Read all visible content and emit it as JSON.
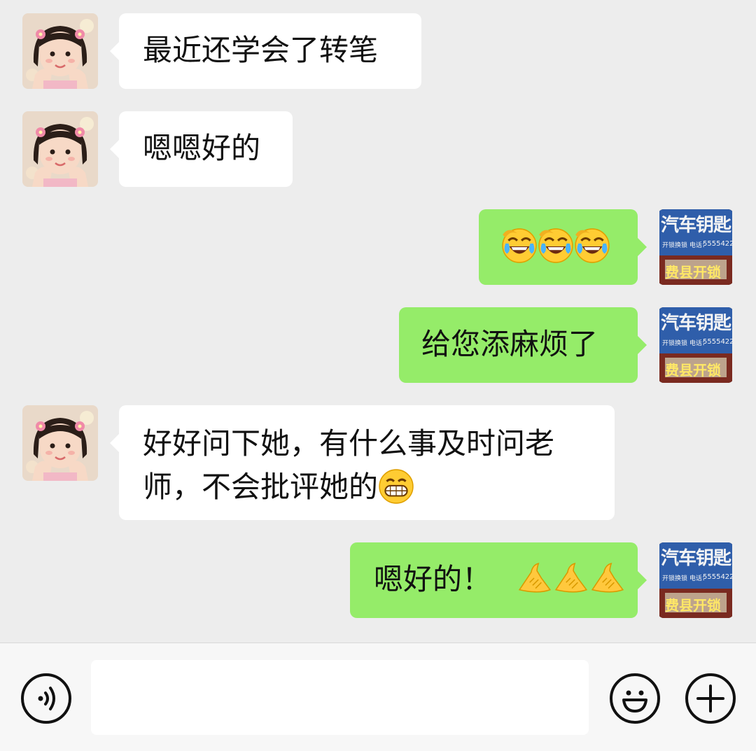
{
  "messages": [
    {
      "side": "left",
      "text": "最近还学会了转笔",
      "sender": "teacher"
    },
    {
      "side": "left",
      "text": "嗯嗯好的",
      "sender": "teacher"
    },
    {
      "side": "right",
      "text": "",
      "emoji": [
        "tears-of-joy-emoji",
        "tears-of-joy-emoji",
        "tears-of-joy-emoji"
      ],
      "sender": "me"
    },
    {
      "side": "right",
      "text": "给您添麻烦了",
      "sender": "me"
    },
    {
      "side": "left",
      "line1": "好好问下她，有什么事及时问老",
      "line2": "师，不会批评她的",
      "emoji": [
        "grinning-face-emoji"
      ],
      "sender": "teacher"
    },
    {
      "side": "right",
      "text": "嗯好的！",
      "emoji": [
        "pointing-hand-emoji",
        "pointing-hand-emoji",
        "pointing-hand-emoji"
      ],
      "sender": "me"
    }
  ],
  "my_avatar": {
    "title": "汽车钥匙",
    "subtitle": "开锁换锁 电话：",
    "phone": "5555422",
    "footer": "费县开锁"
  },
  "input_bar": {
    "voice_icon": "voice-icon",
    "emoji_icon": "smiley-icon",
    "more_icon": "plus-icon"
  },
  "colors": {
    "background": "#ededed",
    "my_bubble": "#95ec69",
    "their_bubble": "#ffffff",
    "input_bar": "#f7f7f7"
  }
}
